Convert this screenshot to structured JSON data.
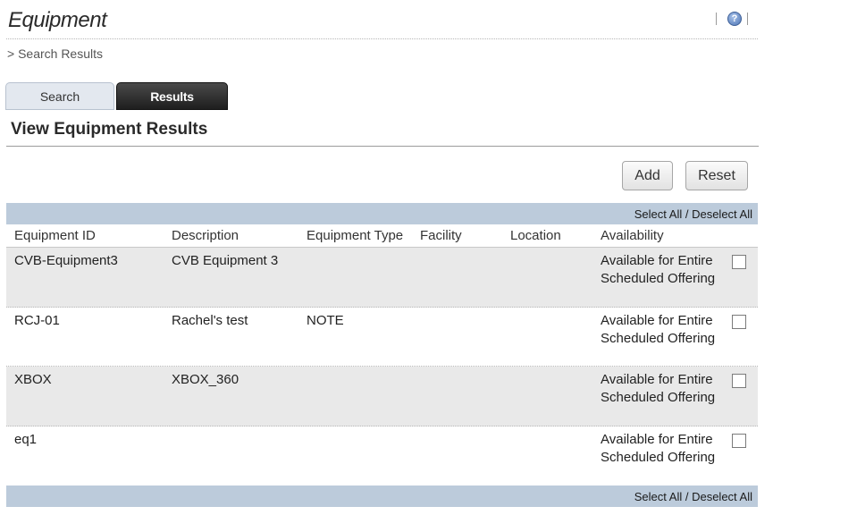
{
  "page": {
    "title": "Equipment",
    "help_icon": "question-mark-help-icon",
    "breadcrumb": "> Search Results"
  },
  "tabs": [
    {
      "label": "Search",
      "active": false
    },
    {
      "label": "Results",
      "active": true
    }
  ],
  "section": {
    "title": "View Equipment Results"
  },
  "actions": {
    "add_label": "Add",
    "reset_label": "Reset"
  },
  "select_bar": {
    "select_all": "Select All",
    "divider": " / ",
    "deselect_all": "Deselect All"
  },
  "table": {
    "columns": [
      "Equipment ID",
      "Description",
      "Equipment Type",
      "Facility",
      "Location",
      "Availability"
    ],
    "rows": [
      {
        "id": "CVB-Equipment3",
        "description": "CVB Equipment 3",
        "type": "",
        "facility": "",
        "location": "",
        "availability": "Available for Entire Scheduled Offering",
        "checked": false
      },
      {
        "id": "RCJ-01",
        "description": "Rachel's test",
        "type": "NOTE",
        "facility": "",
        "location": "",
        "availability": "Available for Entire Scheduled Offering",
        "checked": false
      },
      {
        "id": "XBOX",
        "description": "XBOX_360",
        "type": "",
        "facility": "",
        "location": "",
        "availability": "Available for Entire Scheduled Offering",
        "checked": false
      },
      {
        "id": "eq1",
        "description": "",
        "type": "",
        "facility": "",
        "location": "",
        "availability": "Available for Entire Scheduled Offering",
        "checked": false
      }
    ]
  },
  "colors": {
    "select_bar_bg": "#bccbdb",
    "row_shade": "#e9e9e9",
    "active_tab_bg": "#2b2b2b",
    "inactive_tab_bg": "#e3e8ef"
  }
}
